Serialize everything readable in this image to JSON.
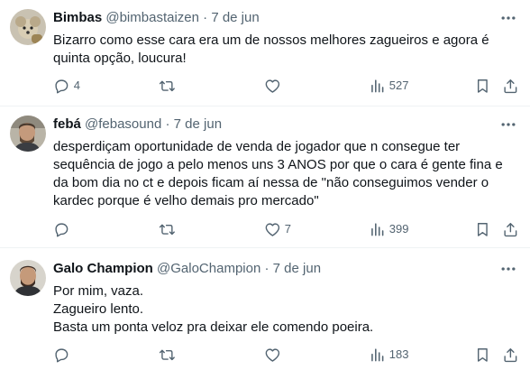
{
  "tweets": [
    {
      "name": "Bimbas",
      "handle": "@bimbastaizen",
      "separator": "·",
      "time": "7 de jun",
      "text": "Bizarro como esse cara era um de nossos melhores zagueiros e agora é quinta opção, loucura!",
      "replies": "4",
      "retweets": "",
      "likes": "",
      "views": "527",
      "avatar_icon": "dog-avatar-icon"
    },
    {
      "name": "febá",
      "handle": "@febasound",
      "separator": "·",
      "time": "7 de jun",
      "text": "desperdiçam oportunidade de venda de jogador que n  consegue ter sequência de jogo a pelo menos uns 3 ANOS por que o cara é gente fina e da bom dia no ct e depois ficam aí nessa de \"não conseguimos vender o kardec porque é velho demais pro mercado\"",
      "replies": "",
      "retweets": "",
      "likes": "7",
      "views": "399",
      "avatar_icon": "person-avatar-icon"
    },
    {
      "name": "Galo Champion",
      "handle": "@GaloChampion",
      "separator": "·",
      "time": "7 de jun",
      "text": "Por mim, vaza.\nZagueiro lento.\nBasta um ponta veloz pra deixar ele comendo poeira.",
      "replies": "",
      "retweets": "",
      "likes": "",
      "views": "183",
      "avatar_icon": "person-avatar-icon"
    }
  ],
  "colors": {
    "text": "#0f1419",
    "secondary": "#536471",
    "divider": "#eff3f4"
  }
}
